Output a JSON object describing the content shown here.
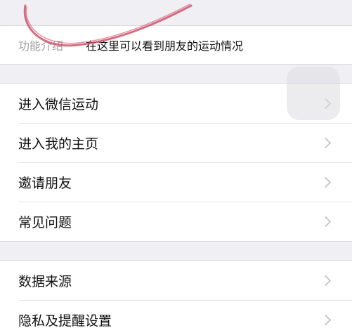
{
  "intro": {
    "label": "功能介绍",
    "text": "在这里可以看到朋友的运动情况"
  },
  "group1": {
    "items": [
      {
        "label": "进入微信运动"
      },
      {
        "label": "进入我的主页"
      },
      {
        "label": "邀请朋友"
      },
      {
        "label": "常见问题"
      }
    ]
  },
  "group2": {
    "items": [
      {
        "label": "数据来源"
      },
      {
        "label": "隐私及提醒设置"
      }
    ]
  },
  "icons": {
    "chevron": "chevron-right-icon",
    "floating": "assistive-touch-icon"
  },
  "colors": {
    "background": "#efeff4",
    "cell": "#ffffff",
    "text": "#111111",
    "secondary_text": "#a0a0a6",
    "chevron": "#c7c7cc",
    "annotation": "#d0506a"
  }
}
